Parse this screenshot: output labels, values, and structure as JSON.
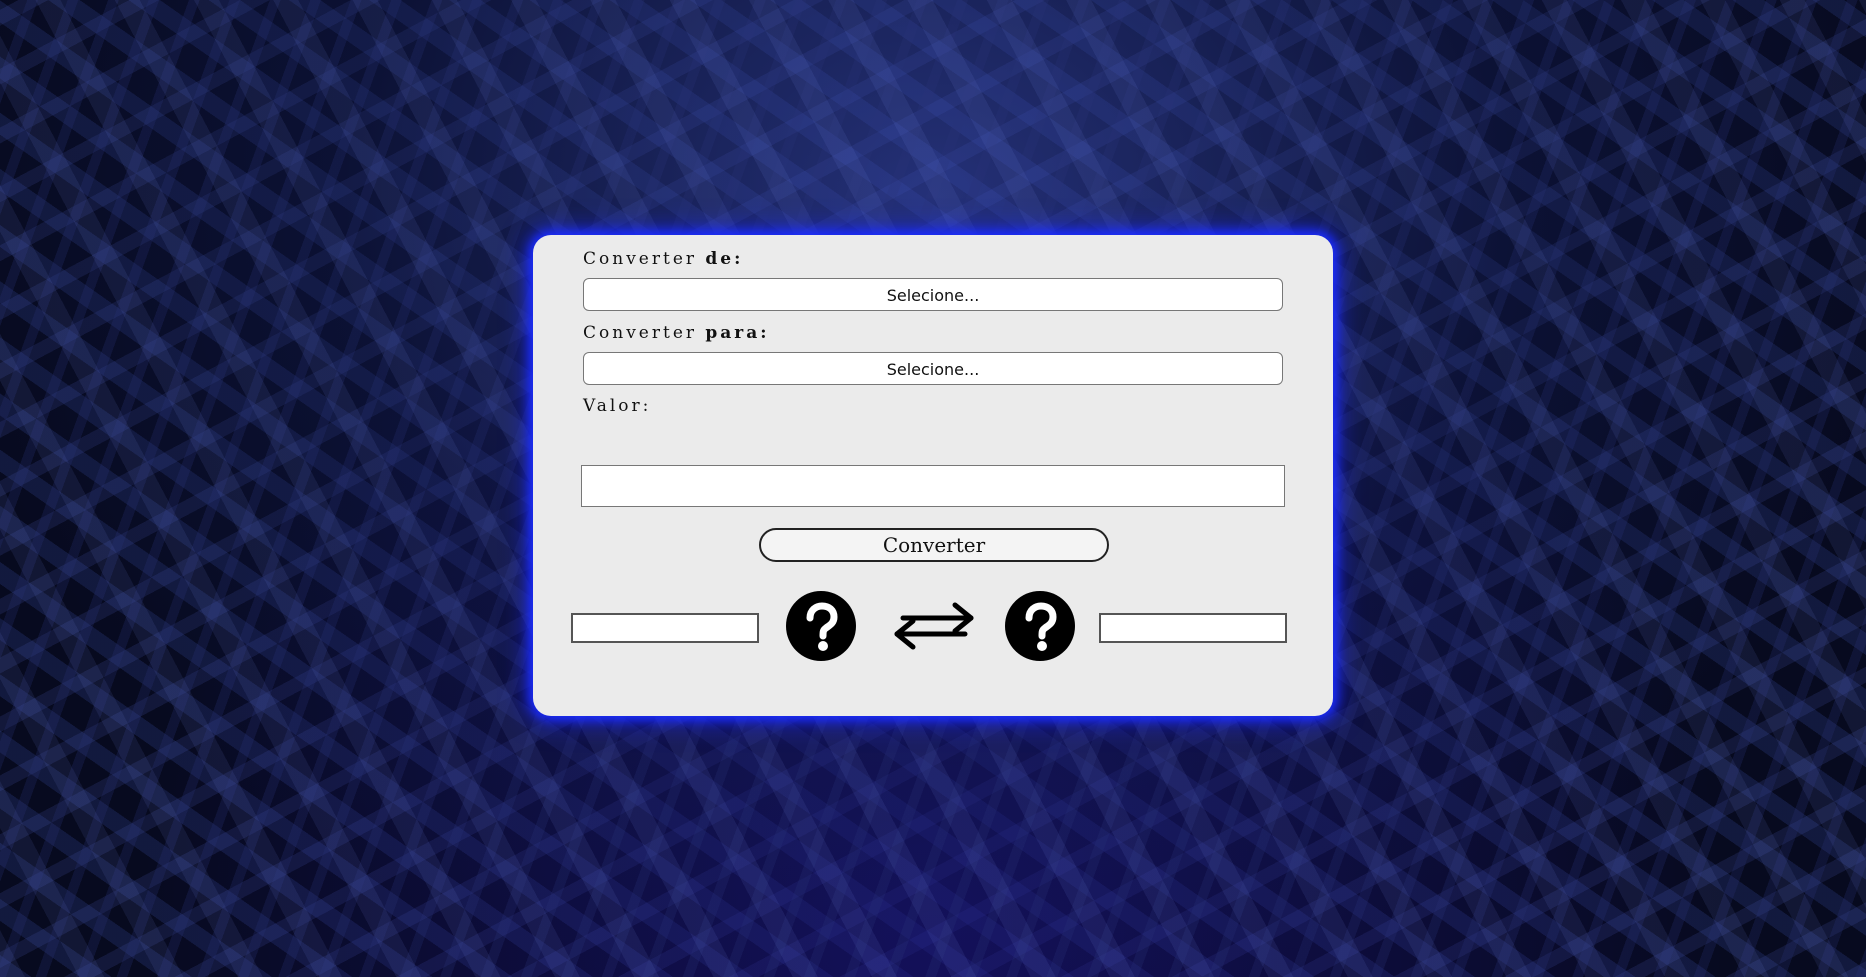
{
  "form": {
    "from_label_prefix": "Converter ",
    "from_label_bold": "de:",
    "from_select_value": "Selecione...",
    "to_label_prefix": "Converter ",
    "to_label_bold": "para:",
    "to_select_value": "Selecione...",
    "value_label": "Valor:",
    "value_input": "",
    "convert_button": "Converter"
  },
  "result": {
    "from_value": "",
    "to_value": "",
    "from_currency_icon": "question-mark-icon",
    "swap_icon": "swap-arrows-icon",
    "to_currency_icon": "question-mark-icon"
  },
  "colors": {
    "card_background": "#ebebeb",
    "card_glow": "#1a2cff",
    "background": "#070a1f"
  }
}
